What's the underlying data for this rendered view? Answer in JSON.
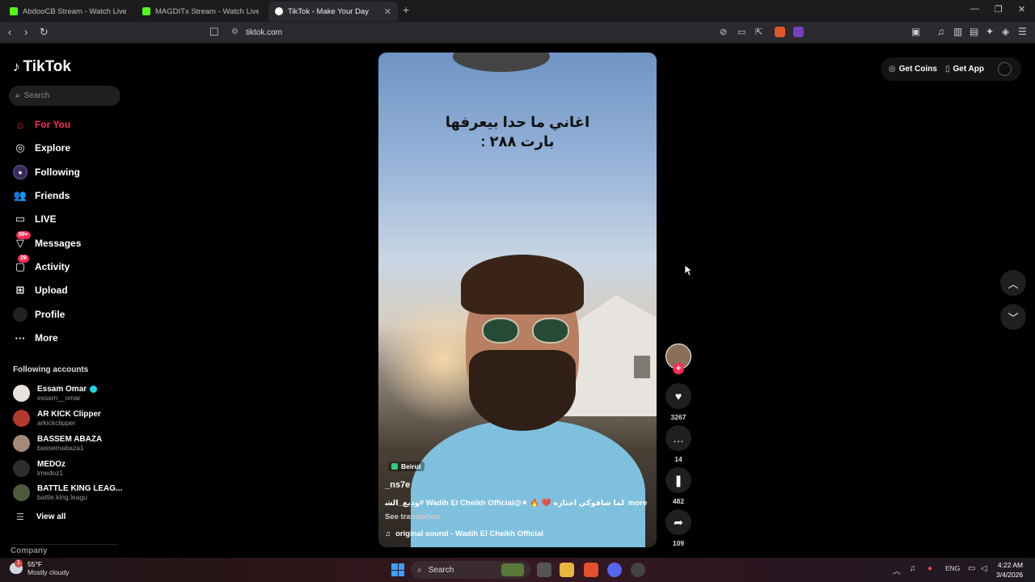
{
  "browser": {
    "tabs": [
      {
        "title": "AbdooCB Stream - Watch Live on Kic",
        "active": false
      },
      {
        "title": "MAGDITx Stream - Watch Live on Kic",
        "active": false
      },
      {
        "title": "TikTok - Make Your Day",
        "active": true
      }
    ],
    "url": "tiktok.com"
  },
  "sidebar": {
    "logo": "TikTok",
    "search_placeholder": "Search",
    "nav": [
      {
        "label": "For You",
        "icon": "home-icon",
        "active": true
      },
      {
        "label": "Explore",
        "icon": "compass-icon"
      },
      {
        "label": "Following",
        "icon": "following-icon"
      },
      {
        "label": "Friends",
        "icon": "friends-icon"
      },
      {
        "label": "LIVE",
        "icon": "live-icon"
      },
      {
        "label": "Messages",
        "icon": "messages-icon",
        "badge": "99+"
      },
      {
        "label": "Activity",
        "icon": "activity-icon",
        "badge": "29"
      },
      {
        "label": "Upload",
        "icon": "upload-icon"
      },
      {
        "label": "Profile",
        "icon": "profile-icon"
      },
      {
        "label": "More",
        "icon": "more-icon"
      }
    ],
    "following_title": "Following accounts",
    "accounts": [
      {
        "name": "Essam Omar",
        "handle": "essam__omar",
        "verified": true
      },
      {
        "name": "AR KICK Clipper",
        "handle": "arkickclipper"
      },
      {
        "name": "BASSEM ABAZA",
        "handle": "bassemabaza1"
      },
      {
        "name": "MEDOz",
        "handle": "lmedoz1"
      },
      {
        "name": "BATTLE KING LEAG...",
        "handle": "battle.king.leagu"
      }
    ],
    "view_all": "View all",
    "company": "Company"
  },
  "video": {
    "overlay_line1": "اغاني ما حدا بيعرفها",
    "overlay_line2": "بارت ٢٨٨ :",
    "location": "Beirut",
    "author": "_ns7e",
    "description": "لما شافوكي احتاره 💔 🔥 ⚫@Wadih El Cheikh Official #وديع_الشيخ ...",
    "more": "more",
    "see_translation": "See translation",
    "sound": "original sound - Wadih El Cheikh Official"
  },
  "actions": {
    "likes": "3267",
    "comments": "14",
    "saves": "482",
    "shares": "109"
  },
  "topright": {
    "get_coins": "Get Coins",
    "get_app": "Get App"
  },
  "taskbar": {
    "weather_temp": "55°F",
    "weather_desc": "Mostly cloudy",
    "weather_badge": "1",
    "search": "Search",
    "lang": "ENG",
    "time": "4:22 AM",
    "date": "3/4/2026"
  }
}
